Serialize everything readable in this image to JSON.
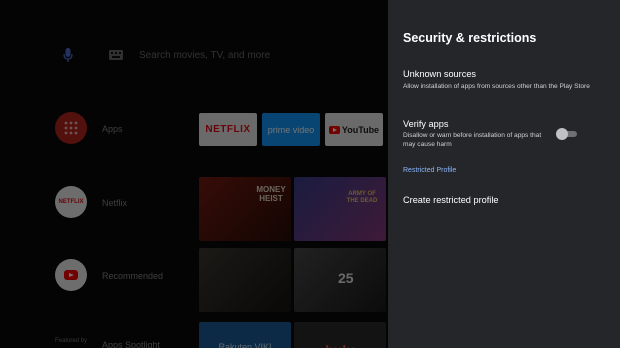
{
  "home": {
    "search_placeholder": "Search movies, TV, and more",
    "rows": [
      {
        "label": "Apps",
        "icon": "apps-grid-icon"
      },
      {
        "label": "Netflix",
        "icon": "netflix-icon"
      },
      {
        "label": "Recommended",
        "icon": "youtube-icon"
      },
      {
        "label": "Apps Spotlight",
        "prefix": "Featured by"
      }
    ],
    "app_tiles": [
      "NETFLIX",
      "prime video",
      "YouTube"
    ],
    "netflix_posters": [
      "MONEY HEIST",
      "ARMY OF THE DEAD"
    ],
    "recommended_posters": [
      "",
      "25"
    ],
    "spotlight_tiles": [
      "Rakuten VIKI",
      "hulu"
    ],
    "colors": {
      "apps_red": "#d32f2f",
      "netflix_red": "#e50914",
      "youtube_red": "#ff0000",
      "prime_blue": "#1399ff"
    }
  },
  "panel": {
    "title": "Security & restrictions",
    "items": [
      {
        "title": "Unknown sources",
        "description": "Allow installation of apps from sources other than the Play Store"
      },
      {
        "title": "Verify apps",
        "description": "Disallow or warn before installation of apps that may cause harm",
        "toggle": "off"
      }
    ],
    "section_label": "Restricted Profile",
    "section_items": [
      {
        "title": "Create restricted profile"
      }
    ],
    "colors": {
      "background": "#24262a",
      "accent": "#8ab4f8"
    }
  }
}
